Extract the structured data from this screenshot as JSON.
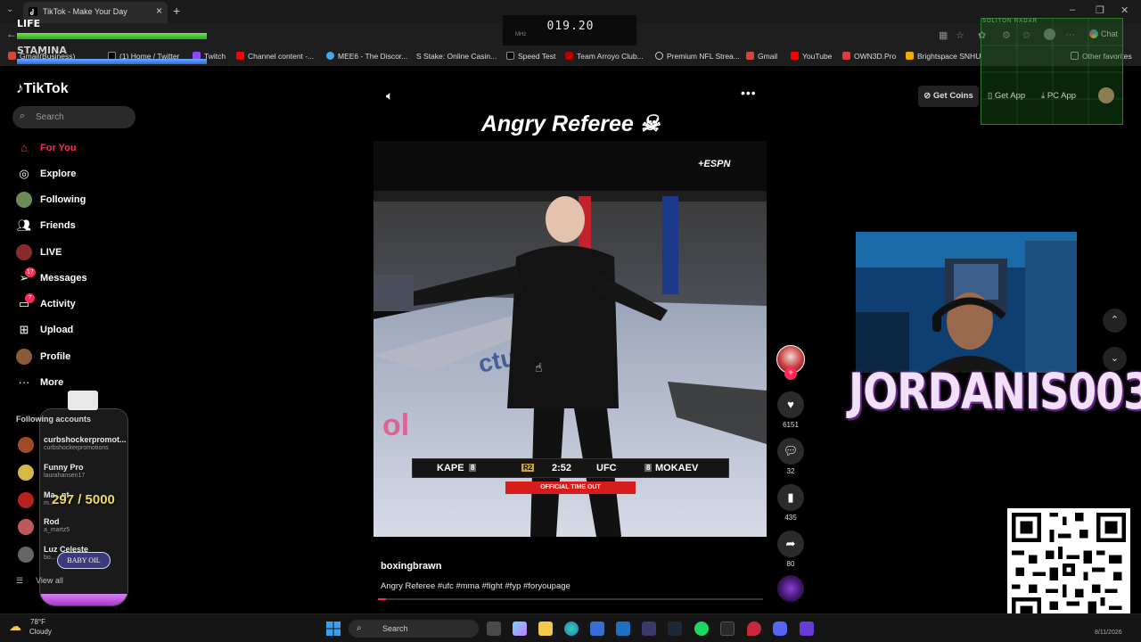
{
  "browser": {
    "tab_title": "TikTok - Make Your Day",
    "bookmarks": [
      "Gmail(Business)",
      "(1) Home / Twitter",
      "Twitch",
      "Channel content -...",
      "MEE6 - The Discor...",
      "Stake: Online Casin...",
      "Speed Test",
      "Team Arroyo Club...",
      "Premium NFL Strea...",
      "Gmail",
      "YouTube",
      "OWN3D.Pro",
      "Brightspace SNHU",
      "Other favorites"
    ],
    "chat_label": "Chat"
  },
  "overlay": {
    "life_label": "LIFE",
    "life_level": 1.0,
    "stamina_label": "STAMINA",
    "stamina_level": 1.0,
    "frequency": "019.20",
    "frequency_unit": "MHz",
    "radar_label": "SOLITON RADAR",
    "oil_count": "297 / 5000",
    "oil_level": 0.06,
    "oil_label": "BABY OIL",
    "streamer_name": "JORDANIS003"
  },
  "tiktok": {
    "logo": "TikTok",
    "search_placeholder": "Search",
    "nav": [
      {
        "label": "For You",
        "icon": "home-icon",
        "badge": ""
      },
      {
        "label": "Explore",
        "icon": "compass-icon",
        "badge": ""
      },
      {
        "label": "Following",
        "icon": "following-avatar-icon",
        "badge": ""
      },
      {
        "label": "Friends",
        "icon": "friends-icon",
        "badge": ""
      },
      {
        "label": "LIVE",
        "icon": "live-icon",
        "badge": ""
      },
      {
        "label": "Messages",
        "icon": "messages-icon",
        "badge": "17"
      },
      {
        "label": "Activity",
        "icon": "activity-icon",
        "badge": "7"
      },
      {
        "label": "Upload",
        "icon": "upload-icon",
        "badge": ""
      },
      {
        "label": "Profile",
        "icon": "profile-icon",
        "badge": ""
      },
      {
        "label": "More",
        "icon": "more-icon",
        "badge": ""
      }
    ],
    "following_title": "Following accounts",
    "accounts": [
      {
        "name": "curbshockerpromot...",
        "handle": "curbshockerpromotions"
      },
      {
        "name": "Funny Pro",
        "handle": "laurahansen17"
      },
      {
        "name": "Ma...nt",
        "handle": "m..."
      },
      {
        "name": "Rod",
        "handle": "a_martz5"
      },
      {
        "name": "Luz Celeste",
        "handle": "bo..."
      }
    ],
    "view_all": "View all",
    "get_coins": "Get Coins",
    "get_app": "Get App",
    "pc_app": "PC App"
  },
  "video": {
    "title": "Angry Referee ☠",
    "network": "ESPN",
    "scorebug": {
      "left_fighter": "KAPE",
      "left_rank": "8",
      "round": "R2",
      "clock": "2:52",
      "league": "UFC",
      "right_rank": "8",
      "right_fighter": "MOKAEV"
    },
    "timeout_text": "OFFICIAL TIME OUT",
    "username": "boxingbrawn",
    "caption": "Angry Referee #ufc #mma #fight #fyp #foryoupage",
    "likes": "6151",
    "comments": "32",
    "saves": "435",
    "shares": "80",
    "progress": 0.02
  },
  "taskbar": {
    "temperature": "78°F",
    "weather": "Cloudy",
    "search_label": "Search",
    "date": "8/11/2026"
  }
}
